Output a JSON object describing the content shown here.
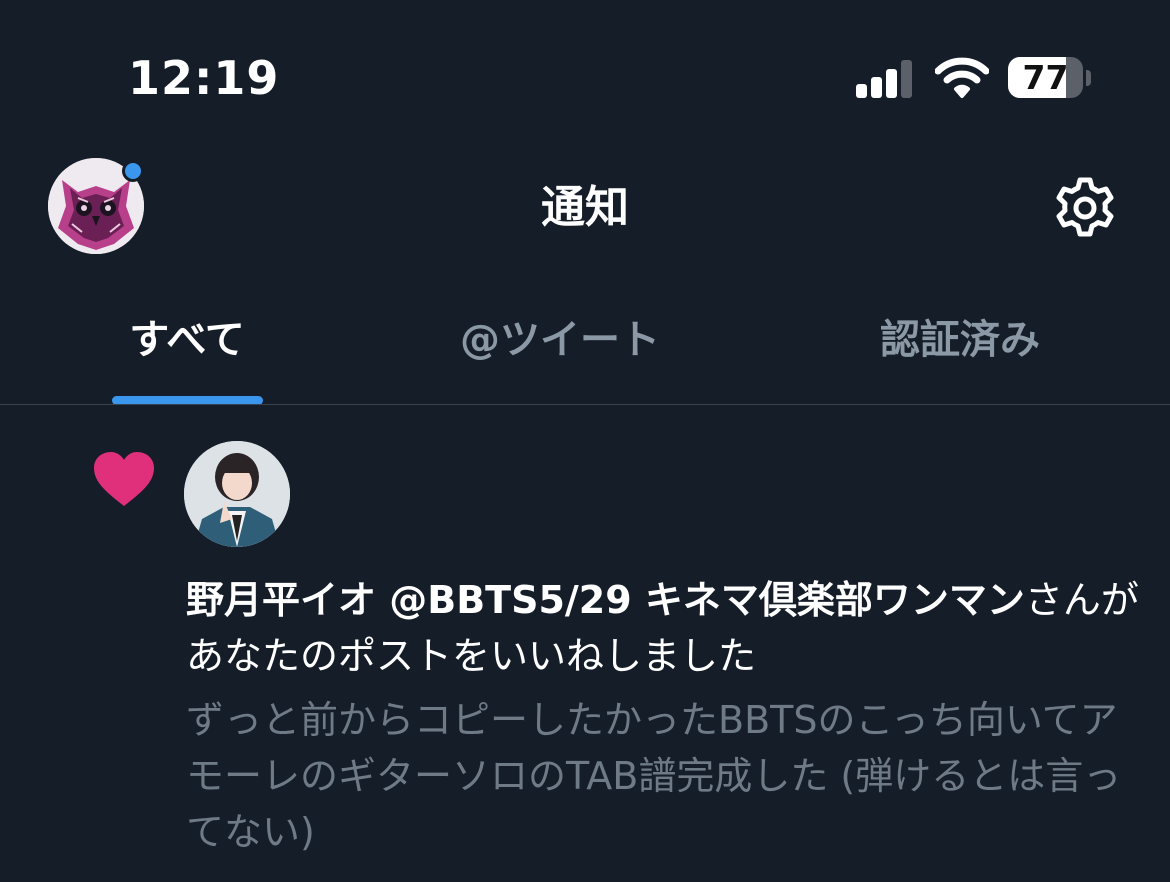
{
  "status_bar": {
    "time": "12:19",
    "battery_percent": "77",
    "battery_level": 0.77,
    "icons": [
      "cellular-signal-icon",
      "wifi-icon",
      "battery-icon"
    ]
  },
  "header": {
    "title": "通知",
    "avatar_icon": "owl-avatar",
    "settings_icon": "gear-icon",
    "accent_color": "#3b97ee"
  },
  "tabs": [
    {
      "label": "すべて",
      "active": true
    },
    {
      "label": "@ツイート",
      "active": false
    },
    {
      "label": "認証済み",
      "active": false
    }
  ],
  "notification": {
    "type_icon": "heart-icon",
    "heart_color": "#e0307c",
    "user_name": "野月平イオ @BBTS5/29 キネマ倶楽部ワンマン",
    "action_text": "さんがあなたのポストをいいねしました",
    "post_snippet": "ずっと前からコピーしたかったBBTSのこっち向いてアモーレのギターソロのTAB譜完成した (弾けるとは言ってない)"
  }
}
